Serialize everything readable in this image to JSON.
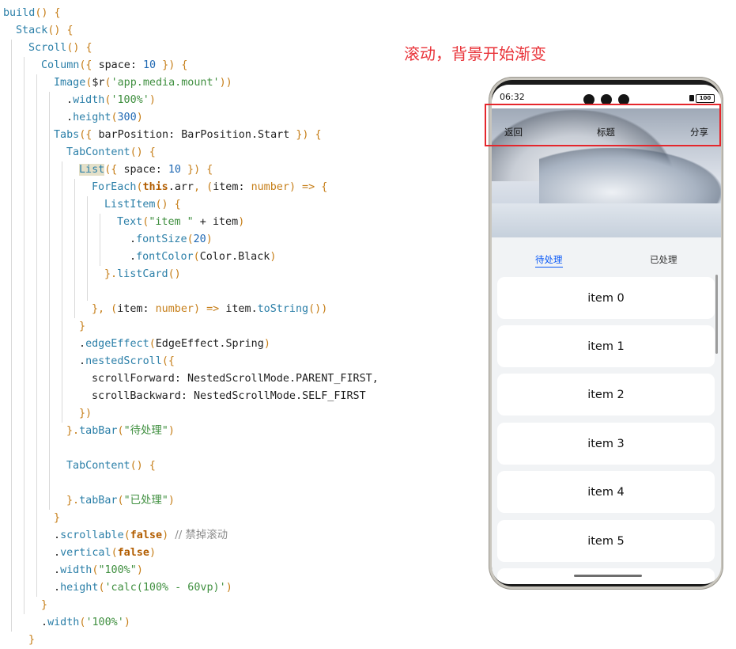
{
  "code_lines": [
    [
      [
        "build",
        "fn"
      ],
      [
        "() {",
        "punct"
      ]
    ],
    [
      [
        "Stack",
        "fn"
      ],
      [
        "() {",
        "punct"
      ]
    ],
    [
      [
        "Scroll",
        "fn"
      ],
      [
        "() {",
        "punct"
      ]
    ],
    [
      [
        "Column",
        "fn"
      ],
      [
        "({ ",
        "punct"
      ],
      [
        "space",
        "plain"
      ],
      [
        ": ",
        "plain"
      ],
      [
        "10",
        "num"
      ],
      [
        " }) {",
        "punct"
      ]
    ],
    [
      [
        "Image",
        "fn"
      ],
      [
        "(",
        "punct"
      ],
      [
        "$r",
        "plain"
      ],
      [
        "(",
        "punct"
      ],
      [
        "'app.media.mount'",
        "str"
      ],
      [
        "))",
        "punct"
      ]
    ],
    [
      [
        ".",
        "plain"
      ],
      [
        "width",
        "fn"
      ],
      [
        "(",
        "punct"
      ],
      [
        "'100%'",
        "str"
      ],
      [
        ")",
        "punct"
      ]
    ],
    [
      [
        ".",
        "plain"
      ],
      [
        "height",
        "fn"
      ],
      [
        "(",
        "punct"
      ],
      [
        "300",
        "num"
      ],
      [
        ")",
        "punct"
      ]
    ],
    [
      [
        "Tabs",
        "fn"
      ],
      [
        "({ ",
        "punct"
      ],
      [
        "barPosition",
        "plain"
      ],
      [
        ": ",
        "plain"
      ],
      [
        "BarPosition",
        "plain"
      ],
      [
        ".",
        "plain"
      ],
      [
        "Start",
        "plain"
      ],
      [
        " }) {",
        "punct"
      ]
    ],
    [
      [
        "TabContent",
        "fn"
      ],
      [
        "() {",
        "punct"
      ]
    ],
    [
      [
        "List",
        "hl"
      ],
      [
        "({ ",
        "punct"
      ],
      [
        "space",
        "plain"
      ],
      [
        ": ",
        "plain"
      ],
      [
        "10",
        "num"
      ],
      [
        " }) {",
        "punct"
      ]
    ],
    [
      [
        "ForEach",
        "fn"
      ],
      [
        "(",
        "punct"
      ],
      [
        "this",
        "kw"
      ],
      [
        ".",
        "plain"
      ],
      [
        "arr",
        "plain"
      ],
      [
        ", (",
        "punct"
      ],
      [
        "item",
        "plain"
      ],
      [
        ": ",
        "plain"
      ],
      [
        "number",
        "type"
      ],
      [
        ") => {",
        "punct"
      ]
    ],
    [
      [
        "ListItem",
        "fn"
      ],
      [
        "() {",
        "punct"
      ]
    ],
    [
      [
        "Text",
        "fn"
      ],
      [
        "(",
        "punct"
      ],
      [
        "\"item \"",
        "str"
      ],
      [
        " + ",
        "plain"
      ],
      [
        "item",
        "plain"
      ],
      [
        ")",
        "punct"
      ]
    ],
    [
      [
        ".",
        "plain"
      ],
      [
        "fontSize",
        "fn"
      ],
      [
        "(",
        "punct"
      ],
      [
        "20",
        "num"
      ],
      [
        ")",
        "punct"
      ]
    ],
    [
      [
        ".",
        "plain"
      ],
      [
        "fontColor",
        "fn"
      ],
      [
        "(",
        "punct"
      ],
      [
        "Color",
        "plain"
      ],
      [
        ".",
        "plain"
      ],
      [
        "Black",
        "plain"
      ],
      [
        ")",
        "punct"
      ]
    ],
    [
      [
        "}.",
        "punct"
      ],
      [
        "listCard",
        "fn"
      ],
      [
        "()",
        "punct"
      ]
    ],
    [],
    [
      [
        "}, (",
        "punct"
      ],
      [
        "item",
        "plain"
      ],
      [
        ": ",
        "plain"
      ],
      [
        "number",
        "type"
      ],
      [
        ") => ",
        "punct"
      ],
      [
        "item",
        "plain"
      ],
      [
        ".",
        "plain"
      ],
      [
        "toString",
        "fn"
      ],
      [
        "())",
        "punct"
      ]
    ],
    [
      [
        "}",
        "punct"
      ]
    ],
    [
      [
        ".",
        "plain"
      ],
      [
        "edgeEffect",
        "fn"
      ],
      [
        "(",
        "punct"
      ],
      [
        "EdgeEffect",
        "plain"
      ],
      [
        ".",
        "plain"
      ],
      [
        "Spring",
        "plain"
      ],
      [
        ")",
        "punct"
      ]
    ],
    [
      [
        ".",
        "plain"
      ],
      [
        "nestedScroll",
        "fn"
      ],
      [
        "({",
        "punct"
      ]
    ],
    [
      [
        "scrollForward",
        "plain"
      ],
      [
        ": ",
        "plain"
      ],
      [
        "NestedScrollMode",
        "plain"
      ],
      [
        ".",
        "plain"
      ],
      [
        "PARENT_FIRST",
        "plain"
      ],
      [
        ",",
        "plain"
      ]
    ],
    [
      [
        "scrollBackward",
        "plain"
      ],
      [
        ": ",
        "plain"
      ],
      [
        "NestedScrollMode",
        "plain"
      ],
      [
        ".",
        "plain"
      ],
      [
        "SELF_FIRST",
        "plain"
      ]
    ],
    [
      [
        "})",
        "punct"
      ]
    ],
    [
      [
        "}.",
        "punct"
      ],
      [
        "tabBar",
        "fn"
      ],
      [
        "(",
        "punct"
      ],
      [
        "\"待处理\"",
        "str"
      ],
      [
        ")",
        "punct"
      ]
    ],
    [],
    [
      [
        "TabContent",
        "fn"
      ],
      [
        "() {",
        "punct"
      ]
    ],
    [],
    [
      [
        "}.",
        "punct"
      ],
      [
        "tabBar",
        "fn"
      ],
      [
        "(",
        "punct"
      ],
      [
        "\"已处理\"",
        "str"
      ],
      [
        ")",
        "punct"
      ]
    ],
    [
      [
        "}",
        "punct"
      ]
    ],
    [
      [
        ".",
        "plain"
      ],
      [
        "scrollable",
        "fn"
      ],
      [
        "(",
        "punct"
      ],
      [
        "false",
        "kw"
      ],
      [
        ") ",
        "punct"
      ],
      [
        "// 禁掉滚动",
        "cm"
      ]
    ],
    [
      [
        ".",
        "plain"
      ],
      [
        "vertical",
        "fn"
      ],
      [
        "(",
        "punct"
      ],
      [
        "false",
        "kw"
      ],
      [
        ")",
        "punct"
      ]
    ],
    [
      [
        ".",
        "plain"
      ],
      [
        "width",
        "fn"
      ],
      [
        "(",
        "punct"
      ],
      [
        "\"100%\"",
        "str"
      ],
      [
        ")",
        "punct"
      ]
    ],
    [
      [
        ".",
        "plain"
      ],
      [
        "height",
        "fn"
      ],
      [
        "(",
        "punct"
      ],
      [
        "'calc(100% - 60vp)'",
        "str"
      ],
      [
        ")",
        "punct"
      ]
    ],
    [
      [
        "}",
        "punct"
      ]
    ],
    [
      [
        ".",
        "plain"
      ],
      [
        "width",
        "fn"
      ],
      [
        "(",
        "punct"
      ],
      [
        "'100%'",
        "str"
      ],
      [
        ")",
        "punct"
      ]
    ],
    [
      [
        "}",
        "punct"
      ]
    ]
  ],
  "annotation": "滚动，背景开始渐变",
  "phone": {
    "status_time": "06:32",
    "battery": "100",
    "nav_back": "返回",
    "nav_title": "标题",
    "nav_share": "分享",
    "tabs": [
      "待处理",
      "已处理"
    ],
    "list_items": [
      "item 0",
      "item 1",
      "item 2",
      "item 3",
      "item 4",
      "item 5"
    ]
  }
}
